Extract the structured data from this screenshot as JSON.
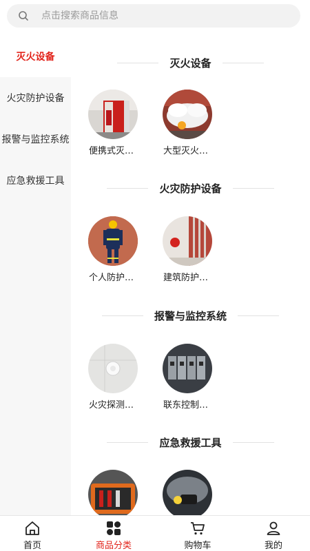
{
  "search": {
    "placeholder": "点击搜索商品信息"
  },
  "sidebar": {
    "items": [
      {
        "label": "灭火设备"
      },
      {
        "label": "火灾防护设备"
      },
      {
        "label": "报警与监控系统"
      },
      {
        "label": "应急救援工具"
      }
    ]
  },
  "sections": [
    {
      "title": "灭火设备",
      "products": [
        {
          "name": "便携式灭…"
        },
        {
          "name": "大型灭火…"
        }
      ]
    },
    {
      "title": "火灾防护设备",
      "products": [
        {
          "name": "个人防护…"
        },
        {
          "name": "建筑防护…"
        }
      ]
    },
    {
      "title": "报警与监控系统",
      "products": [
        {
          "name": "火灾探测…"
        },
        {
          "name": "联东控制…"
        }
      ]
    },
    {
      "title": "应急救援工具",
      "products": [
        {
          "name": ""
        },
        {
          "name": ""
        }
      ]
    }
  ],
  "tabbar": {
    "items": [
      {
        "label": "首页",
        "icon": "home-icon"
      },
      {
        "label": "商品分类",
        "icon": "category-icon"
      },
      {
        "label": "购物车",
        "icon": "cart-icon"
      },
      {
        "label": "我的",
        "icon": "user-icon"
      }
    ]
  },
  "colors": {
    "accent": "#e2231a",
    "sidebar_bg": "#f7f7f7",
    "search_bg": "#f2f2f2"
  }
}
